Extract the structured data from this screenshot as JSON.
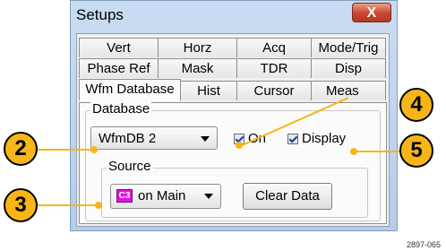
{
  "window": {
    "title": "Setups",
    "close_label": "X"
  },
  "tabs": {
    "row1": [
      "Vert",
      "Horz",
      "Acq",
      "Mode/Trig"
    ],
    "row2": [
      "Phase Ref",
      "Mask",
      "TDR",
      "Disp"
    ],
    "row3": [
      "Wfm Database",
      "Hist",
      "Cursor",
      "Meas"
    ],
    "active": "Wfm Database"
  },
  "database": {
    "group_label": "Database",
    "selected": "WfmDB 2",
    "on_label": "On",
    "display_label": "Display",
    "on_checked": true,
    "display_checked": true
  },
  "source": {
    "group_label": "Source",
    "channel_badge": "C3",
    "selected": "on Main",
    "clear_label": "Clear Data",
    "badge_color": "#e70ce7"
  },
  "callouts": [
    "2",
    "3",
    "4",
    "5"
  ],
  "figure_code": "2897-065"
}
